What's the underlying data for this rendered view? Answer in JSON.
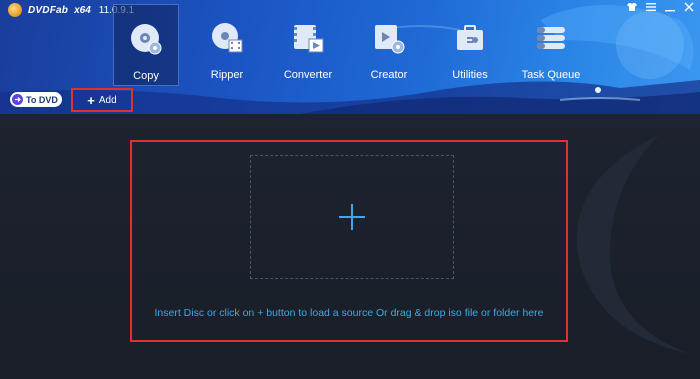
{
  "app": {
    "brand": "DVDFab",
    "arch": "x64",
    "version": "11.0.9.1"
  },
  "window_controls": [
    "shirt-icon",
    "menu-icon",
    "minimize-icon",
    "close-icon"
  ],
  "nav": [
    {
      "label": "Copy",
      "icon": "disc-copy-icon",
      "active": true
    },
    {
      "label": "Ripper",
      "icon": "disc-ripper-icon",
      "active": false
    },
    {
      "label": "Converter",
      "icon": "film-converter-icon",
      "active": false
    },
    {
      "label": "Creator",
      "icon": "film-creator-icon",
      "active": false
    },
    {
      "label": "Utilities",
      "icon": "toolbox-icon",
      "active": false
    },
    {
      "label": "Task Queue",
      "icon": "task-queue-icon",
      "active": false
    }
  ],
  "toolbar": {
    "to_dvd_label": "To DVD",
    "add_label": "Add"
  },
  "dropzone": {
    "hint": "Insert Disc or click on + button to load a source Or drag & drop iso file or folder here"
  },
  "colors": {
    "accent": "#3fa9e8",
    "highlight_border": "#e23030",
    "header_start": "#1a3d9c",
    "header_end": "#3b97ef",
    "background": "#1a1f29"
  }
}
